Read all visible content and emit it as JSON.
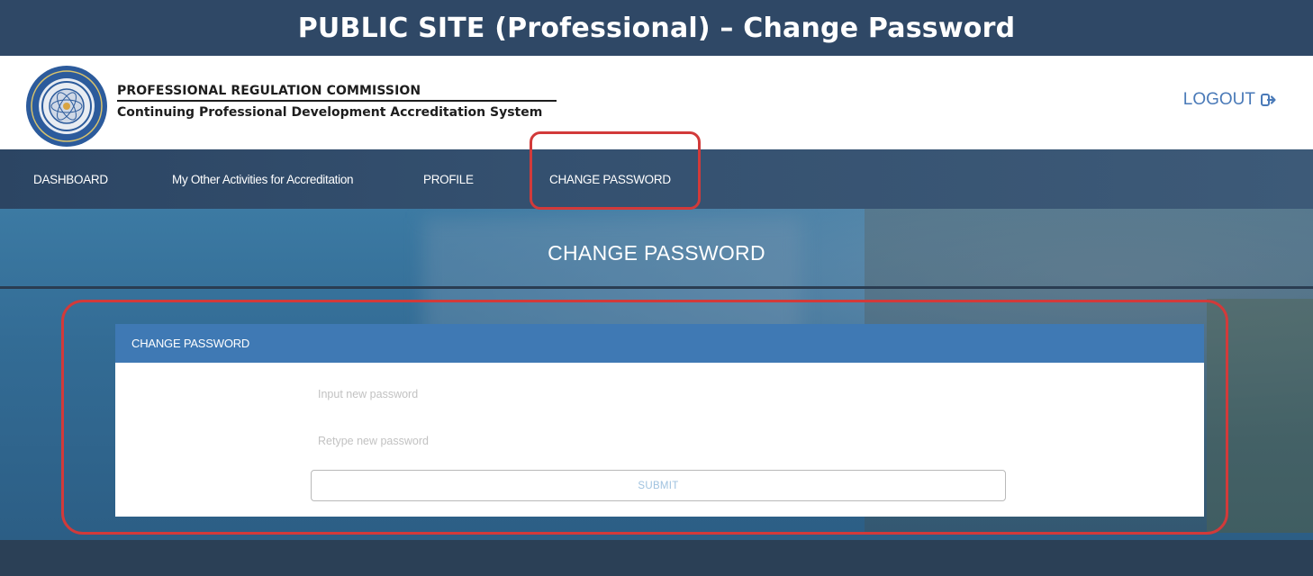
{
  "banner": {
    "title": "PUBLIC SITE (Professional) – Change Password"
  },
  "header": {
    "org_name": "PROFESSIONAL REGULATION COMMISSION",
    "org_subtitle": "Continuing Professional Development Accreditation System",
    "logout_label": "LOGOUT",
    "logout_icon": "sign-out-icon"
  },
  "nav": {
    "items": [
      {
        "label": "DASHBOARD"
      },
      {
        "label": "My Other Activities for Accreditation"
      },
      {
        "label": "PROFILE"
      },
      {
        "label": "CHANGE PASSWORD"
      }
    ],
    "active_index": 3
  },
  "hero": {
    "title": "CHANGE PASSWORD"
  },
  "form": {
    "heading": "CHANGE PASSWORD",
    "new_password_placeholder": "Input new password",
    "new_password_value": "",
    "retype_password_placeholder": "Retype new password",
    "retype_password_value": "",
    "submit_label": "SUBMIT"
  },
  "colors": {
    "banner": "#2f4866",
    "navbar": "#34506f",
    "panel_heading": "#3f79b4",
    "highlight": "#d23a3a",
    "logout_text": "#4a7ab8"
  }
}
